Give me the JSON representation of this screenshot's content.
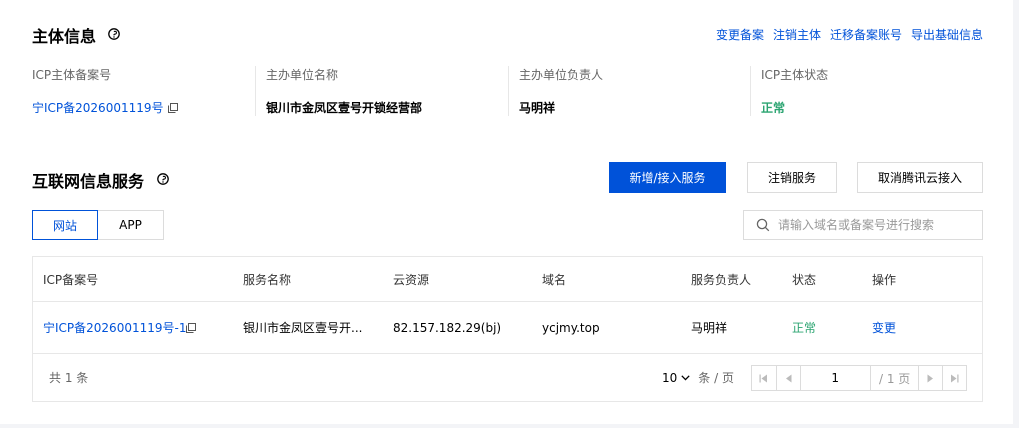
{
  "entity": {
    "title": "主体信息",
    "actions": [
      "变更备案",
      "注销主体",
      "迁移备案账号",
      "导出基础信息"
    ],
    "fields": [
      {
        "label": "ICP主体备案号",
        "value": "宁ICP备2026001119号"
      },
      {
        "label": "主办单位名称",
        "value": "银川市金凤区壹号开锁经营部"
      },
      {
        "label": "主办单位负责人",
        "value": "马明祥"
      },
      {
        "label": "ICP主体状态",
        "value": "正常"
      }
    ]
  },
  "services": {
    "title": "互联网信息服务",
    "buttons": {
      "add": "新增/接入服务",
      "cancel": "注销服务",
      "unlink": "取消腾讯云接入"
    },
    "tabs": [
      {
        "label": "网站",
        "active": true
      },
      {
        "label": "APP",
        "active": false
      }
    ],
    "search": {
      "placeholder": "请输入域名或备案号进行搜索"
    },
    "table": {
      "columns": [
        "ICP备案号",
        "服务名称",
        "云资源",
        "域名",
        "服务负责人",
        "状态",
        "操作"
      ],
      "rows": [
        [
          "宁ICP备2026001119号-1",
          "银川市金凤区壹号开...",
          "82.157.182.29(bj)",
          "ycjmy.top",
          "马明祥",
          "正常",
          "变更"
        ]
      ]
    },
    "pagination": {
      "total": "共 1 条",
      "page_size": "10",
      "page_size_unit": "条 / 页",
      "current_page": "1",
      "total_pages": "/ 1 页"
    }
  },
  "colors": {
    "primary": "#0052d9",
    "success": "#2ba471"
  }
}
